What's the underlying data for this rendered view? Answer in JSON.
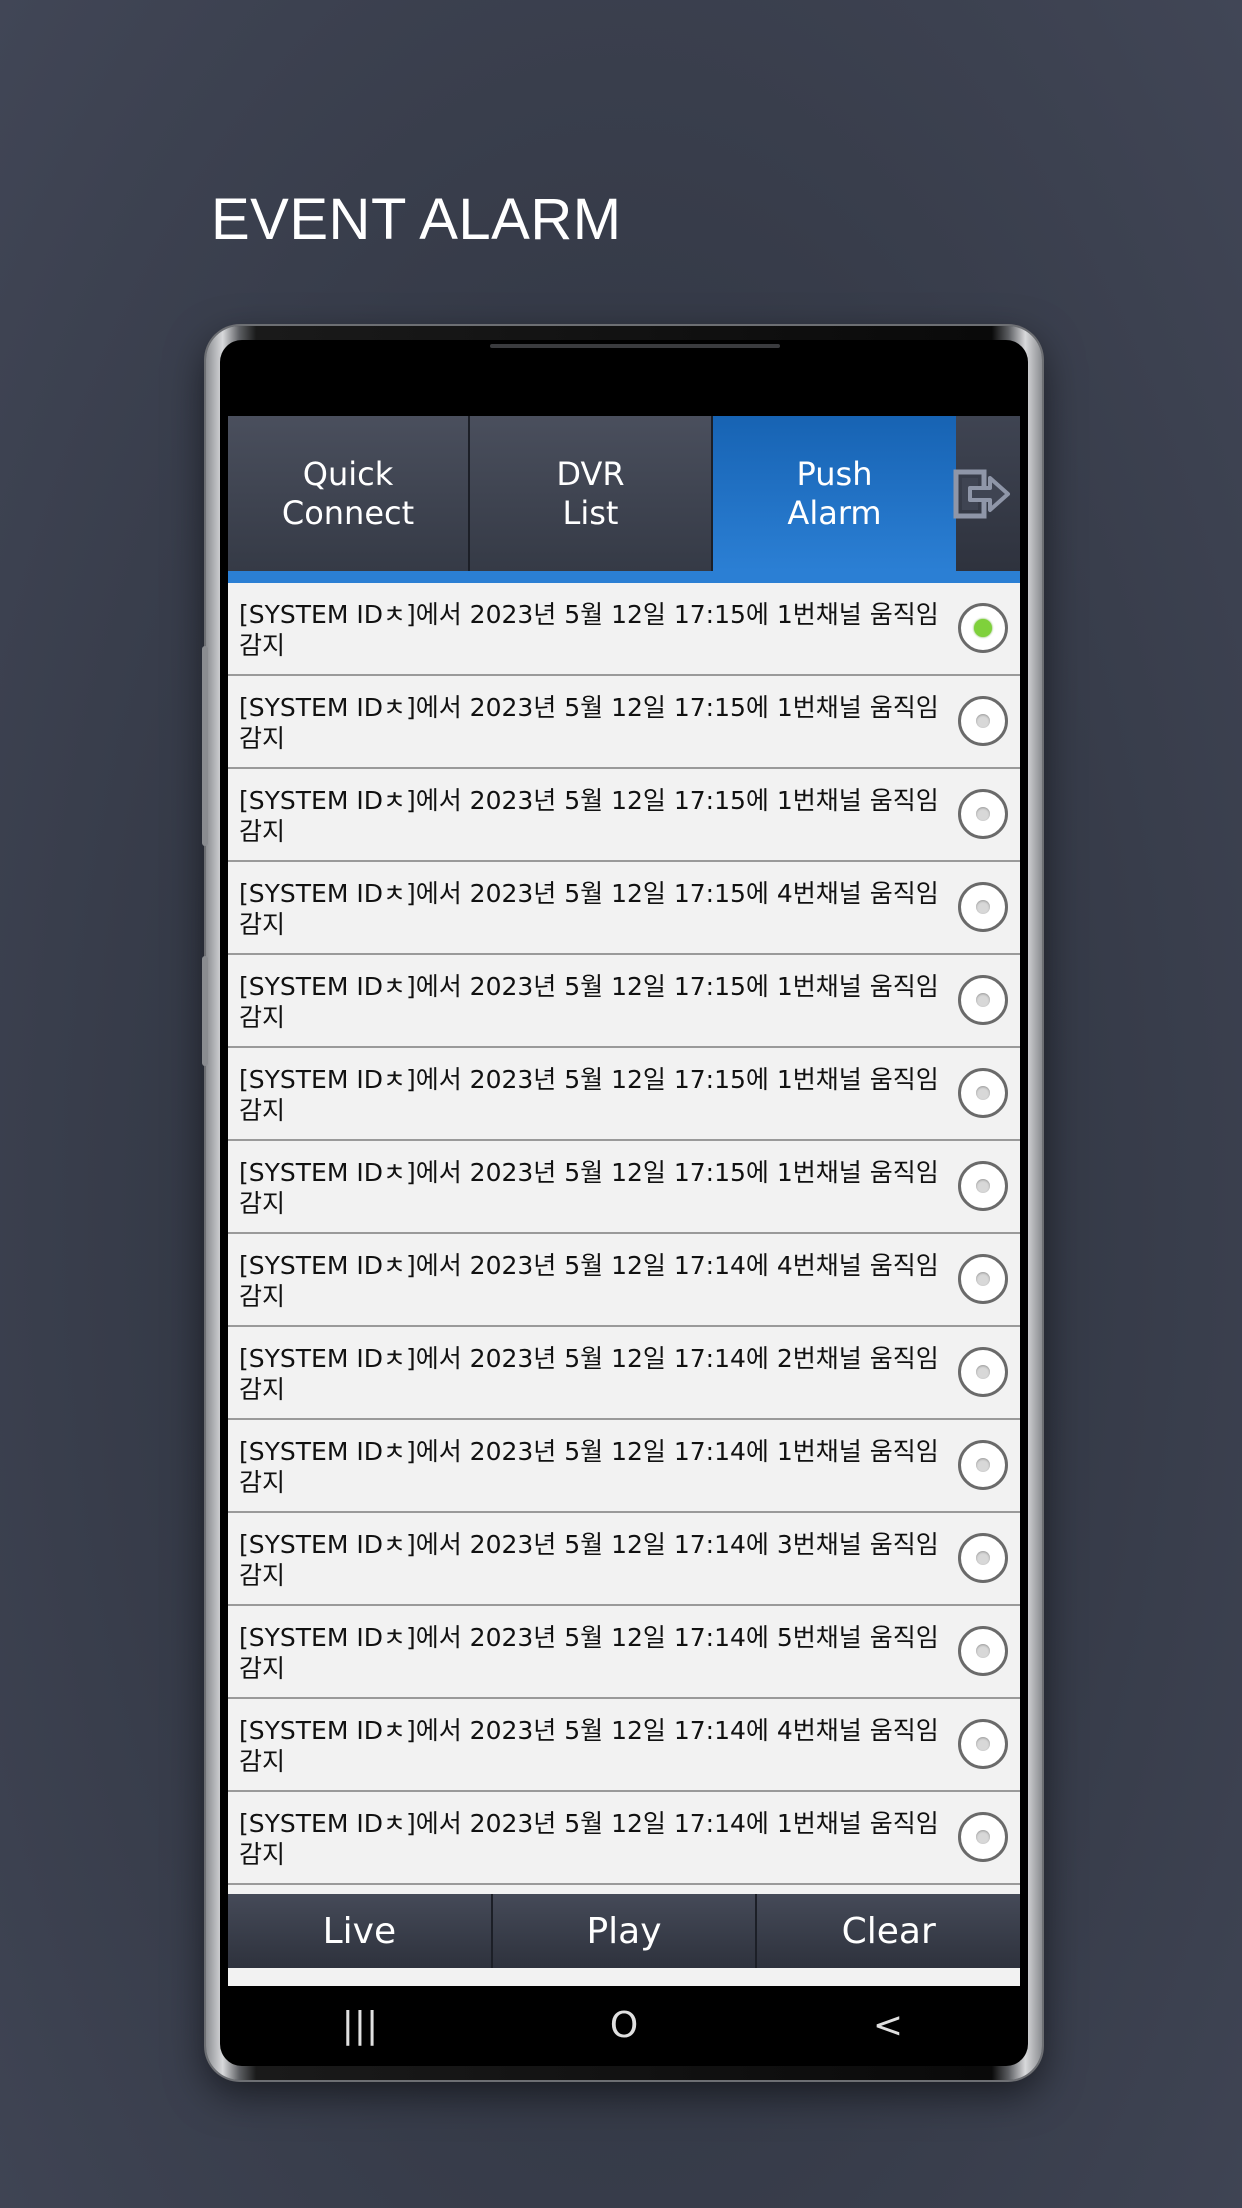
{
  "headline": "EVENT ALARM",
  "tabs": [
    {
      "label": "Quick\nConnect",
      "active": false
    },
    {
      "label": "DVR\nList",
      "active": false
    },
    {
      "label": "Push\nAlarm",
      "active": true
    }
  ],
  "exit_icon": "exit-icon",
  "alarms": [
    {
      "text": "[SYSTEM IDㅊ]에서 2023년 5월 12일 17:15에 1번채널 움직임 감지",
      "selected": true
    },
    {
      "text": "[SYSTEM IDㅊ]에서 2023년 5월 12일 17:15에 1번채널 움직임 감지",
      "selected": false
    },
    {
      "text": "[SYSTEM IDㅊ]에서 2023년 5월 12일 17:15에 1번채널 움직임 감지",
      "selected": false
    },
    {
      "text": "[SYSTEM IDㅊ]에서 2023년 5월 12일 17:15에 4번채널 움직임 감지",
      "selected": false
    },
    {
      "text": "[SYSTEM IDㅊ]에서 2023년 5월 12일 17:15에 1번채널 움직임 감지",
      "selected": false
    },
    {
      "text": "[SYSTEM IDㅊ]에서 2023년 5월 12일 17:15에 1번채널 움직임 감지",
      "selected": false
    },
    {
      "text": "[SYSTEM IDㅊ]에서 2023년 5월 12일 17:15에 1번채널 움직임 감지",
      "selected": false
    },
    {
      "text": "[SYSTEM IDㅊ]에서 2023년 5월 12일 17:14에 4번채널 움직임 감지",
      "selected": false
    },
    {
      "text": "[SYSTEM IDㅊ]에서 2023년 5월 12일 17:14에 2번채널 움직임 감지",
      "selected": false
    },
    {
      "text": "[SYSTEM IDㅊ]에서 2023년 5월 12일 17:14에 1번채널 움직임 감지",
      "selected": false
    },
    {
      "text": "[SYSTEM IDㅊ]에서 2023년 5월 12일 17:14에 3번채널 움직임 감지",
      "selected": false
    },
    {
      "text": "[SYSTEM IDㅊ]에서 2023년 5월 12일 17:14에 5번채널 움직임 감지",
      "selected": false
    },
    {
      "text": "[SYSTEM IDㅊ]에서 2023년 5월 12일 17:14에 4번채널 움직임 감지",
      "selected": false
    },
    {
      "text": "[SYSTEM IDㅊ]에서 2023년 5월 12일 17:14에 1번채널 움직임 감지",
      "selected": false
    }
  ],
  "bottom_bar": {
    "live": "Live",
    "play": "Play",
    "clear": "Clear"
  },
  "navbar": {
    "recents": "|||",
    "home": "O",
    "back": "<"
  },
  "colors": {
    "accent": "#2b7fd4",
    "selected_dot": "#7fd13b",
    "background": "#343946"
  }
}
